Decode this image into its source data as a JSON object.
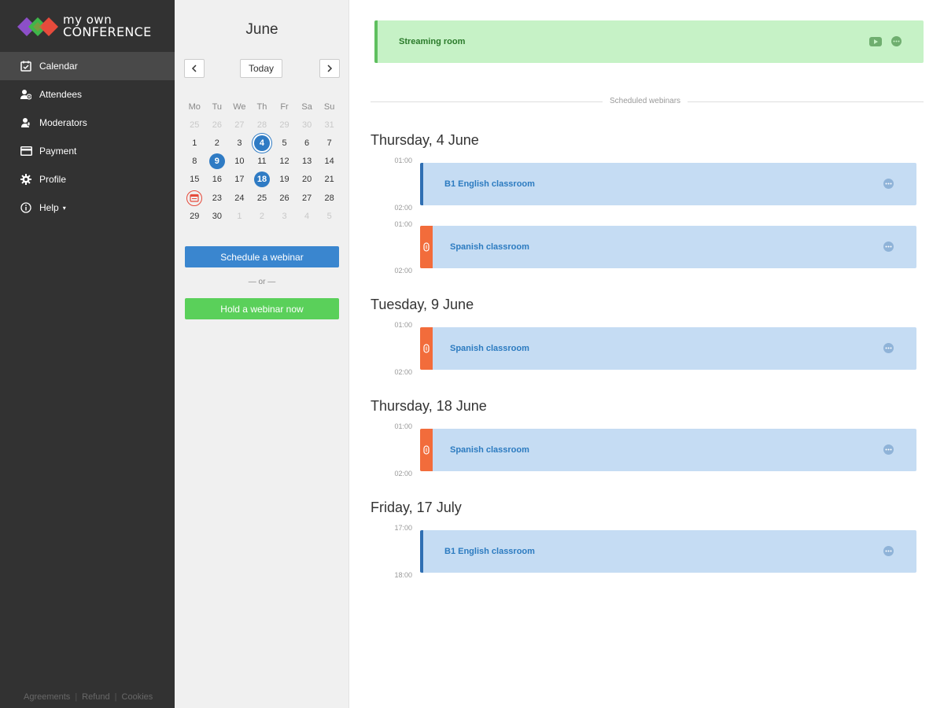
{
  "logo": {
    "line1": "my own",
    "line2": "CONFERENCE"
  },
  "nav": {
    "items": [
      {
        "label": "Calendar",
        "icon": "calendar-icon"
      },
      {
        "label": "Attendees",
        "icon": "attendees-icon"
      },
      {
        "label": "Moderators",
        "icon": "microphone-icon"
      },
      {
        "label": "Payment",
        "icon": "credit-card-icon"
      },
      {
        "label": "Profile",
        "icon": "gear-icon"
      },
      {
        "label": "Help",
        "icon": "info-icon"
      }
    ]
  },
  "footer": {
    "agreements": "Agreements",
    "refund": "Refund",
    "cookies": "Cookies"
  },
  "calendar": {
    "month": "June",
    "today_label": "Today",
    "weekdays": [
      "Mo",
      "Tu",
      "We",
      "Th",
      "Fr",
      "Sa",
      "Su"
    ],
    "weeks": [
      [
        "25",
        "26",
        "27",
        "28",
        "29",
        "30",
        "31"
      ],
      [
        "1",
        "2",
        "3",
        "4",
        "5",
        "6",
        "7"
      ],
      [
        "8",
        "9",
        "10",
        "11",
        "12",
        "13",
        "14"
      ],
      [
        "15",
        "16",
        "17",
        "18",
        "19",
        "20",
        "21"
      ],
      [
        "",
        "23",
        "24",
        "25",
        "26",
        "27",
        "28"
      ],
      [
        "29",
        "30",
        "1",
        "2",
        "3",
        "4",
        "5"
      ]
    ],
    "schedule_label": "Schedule a webinar",
    "or_label": "— or —",
    "hold_label": "Hold a webinar now"
  },
  "main": {
    "streaming_room": "Streaming room",
    "scheduled_label": "Scheduled webinars",
    "days": [
      {
        "heading": "Thursday, 4 June",
        "events": [
          {
            "start": "01:00",
            "end": "02:00",
            "title": "B1 English classroom",
            "kind": "blue"
          },
          {
            "start": "01:00",
            "end": "02:00",
            "title": "Spanish classroom",
            "kind": "orange"
          }
        ]
      },
      {
        "heading": "Tuesday, 9 June",
        "events": [
          {
            "start": "01:00",
            "end": "02:00",
            "title": "Spanish classroom",
            "kind": "orange"
          }
        ]
      },
      {
        "heading": "Thursday, 18 June",
        "events": [
          {
            "start": "01:00",
            "end": "02:00",
            "title": "Spanish classroom",
            "kind": "orange"
          }
        ]
      },
      {
        "heading": "Friday, 17 July",
        "events": [
          {
            "start": "17:00",
            "end": "18:00",
            "title": "B1 English classroom",
            "kind": "blue"
          }
        ]
      }
    ]
  },
  "colors": {
    "sidebar": "#323232",
    "accent_blue": "#3a86cf",
    "accent_green": "#5ad05a",
    "event_bg": "#c5dcf3",
    "orange": "#f26c3b"
  }
}
